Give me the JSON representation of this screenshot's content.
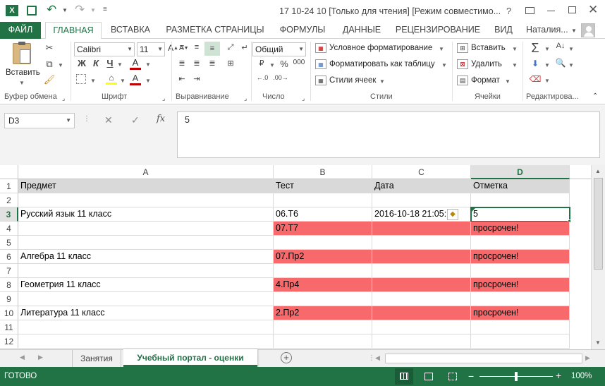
{
  "window": {
    "title": "17 10-24 10  [Только для чтения]  [Режим совместимо...",
    "help": "?"
  },
  "qat": {
    "excel_icon": "X"
  },
  "tabs": [
    "ФАЙЛ",
    "ГЛАВНАЯ",
    "ВСТАВКА",
    "РАЗМЕТКА СТРАНИЦЫ",
    "ФОРМУЛЫ",
    "ДАННЫЕ",
    "РЕЦЕНЗИРОВАНИЕ",
    "ВИД"
  ],
  "user": "Наталия...",
  "ribbon": {
    "clipboard": {
      "paste": "Вставить",
      "label": "Буфер обмена"
    },
    "font": {
      "name": "Calibri",
      "size": "11",
      "bold": "Ж",
      "italic": "К",
      "underline": "Ч",
      "label": "Шрифт"
    },
    "alignment": {
      "label": "Выравнивание"
    },
    "number": {
      "format": "Общий",
      "percent": "%",
      "thousands": "000",
      "label": "Число"
    },
    "styles": {
      "conditional": "Условное форматирование",
      "as_table": "Форматировать как таблицу",
      "cell_styles": "Стили ячеек",
      "label": "Стили"
    },
    "cells": {
      "insert": "Вставить",
      "delete": "Удалить",
      "format": "Формат",
      "label": "Ячейки"
    },
    "editing": {
      "label": "Редактирова..."
    }
  },
  "formula": {
    "namebox": "D3",
    "fx": "fx",
    "value": "5"
  },
  "columns": [
    {
      "id": "A"
    },
    {
      "id": "B"
    },
    {
      "id": "C"
    },
    {
      "id": "D"
    }
  ],
  "rows": [
    {
      "n": "1",
      "a": "Предмет",
      "b": "Тест",
      "c": "Дата",
      "d": "Отметка"
    },
    {
      "n": "2",
      "a": "",
      "b": "",
      "c": "",
      "d": ""
    },
    {
      "n": "3",
      "a": "Русский язык 11 класс",
      "b": "06.Т6",
      "c": "2016-10-18 21:05:",
      "d": "5"
    },
    {
      "n": "4",
      "a": "",
      "b": "07.Т7",
      "c": "",
      "d": "просрочен!"
    },
    {
      "n": "5",
      "a": "",
      "b": "",
      "c": "",
      "d": ""
    },
    {
      "n": "6",
      "a": "Алгебра 11 класс",
      "b": "07.Пр2",
      "c": "",
      "d": "просрочен!"
    },
    {
      "n": "7",
      "a": "",
      "b": "",
      "c": "",
      "d": ""
    },
    {
      "n": "8",
      "a": "Геометрия 11 класс",
      "b": "4.Пр4",
      "c": "",
      "d": "просрочен!"
    },
    {
      "n": "9",
      "a": "",
      "b": "",
      "c": "",
      "d": ""
    },
    {
      "n": "10",
      "a": "Литература 11 класс",
      "b": "2.Пр2",
      "c": "",
      "d": "просрочен!"
    },
    {
      "n": "11",
      "a": "",
      "b": "",
      "c": "",
      "d": ""
    },
    {
      "n": "12",
      "a": "",
      "b": "",
      "c": "",
      "d": ""
    }
  ],
  "sheets": [
    "Занятия",
    "Учебный портал - оценки"
  ],
  "status": {
    "ready": "ГОТОВО",
    "zoom": "100%",
    "minus": "−",
    "plus": "+"
  },
  "colors": {
    "accent": "#217346",
    "red_fill": "#f8696b",
    "header_fill": "#d9d9d9"
  }
}
